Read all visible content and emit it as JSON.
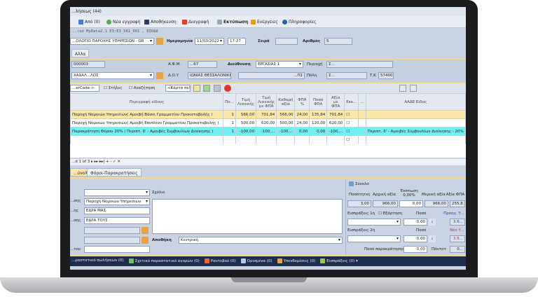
{
  "window": {
    "title": "...λήσεως (44)"
  },
  "toolbar": {
    "from": "Από (0)",
    "new": "Νέα εγγραφή",
    "save": "Αποθήκευση",
    "delete": "Διαγραφή",
    "print": "Εκτύπωση",
    "actions": "Ενέργειες",
    "info": "Πληροφορίες"
  },
  "path": "...ικό MyData2.1 Ε3:Ε3_561_001 , ΕΣΟΔΑ",
  "header": {
    "series": "...ΟΛΟΓΙΟ ΠΑΡΟΧΗΣ ΥΠΗΡΕΣΙΩΝ - GR",
    "date_label": "Ημερομηνία",
    "date": "11/03/2022",
    "time": "17:27",
    "seira_label": "Σειρά",
    "seira": "",
    "number_label": "Αριθμός",
    "number": "5"
  },
  "tabs_top": [
    "Αλλα"
  ],
  "customer": {
    "code": "000003",
    "name": "ΧΑΧΑΛ...ΛΟΣ",
    "afm_label": "Α.Φ.Μ.",
    "afm": "...67",
    "doy_label": "Δ.Ο.Υ",
    "doy": "ΙΩΝΙΑΣ ΘΕΣΣΑΛΟΝΙΚΗ",
    "address_label": "Διεύθυνση",
    "address": "ΕΡΓΑΣΙΑΣ 1",
    "area_label": "Περιοχή",
    "area": "Σ...",
    "street": "...ΠΣ",
    "city_label": "Πόλη",
    "city": "Σ...",
    "tk_label": "Τ.Κ",
    "tk": "57400"
  },
  "grid_toolbar": {
    "barcode": "...erCode >",
    "columns": "Στήλες",
    "search": "Αναζήτηση",
    "card": "<Κάρτα πελά"
  },
  "grid": {
    "headers": [
      "Περιγραφή είδους",
      "Πο...",
      "Τιμή Λιανικής",
      "Τιμή Λιανικής με ΦΠΑ",
      "Καθαρή αξία",
      "ΦΠΑ %",
      "Ποσό ΦΠΑ",
      "Αξία με ΦΠΑ",
      "Εκκ...",
      "...",
      "ΑΑΔΕ Είδος"
    ],
    "rows": [
      [
        "Παροχή Νομικών Υπηρεσιών( Αμοιβή Βάσει Γραμματίου Προκαταβολής )",
        "1",
        "566,00",
        "701,84",
        "566,00",
        "24,00",
        "135,84",
        "701,84",
        "",
        "",
        ""
      ],
      [
        "Παροχή Νομικών Υπηρεσιών( Αμοιβή Επιπλέον Γραμματίου Προκαταβολής )",
        "1",
        "500,00",
        "620,00",
        "500,00",
        "24,00",
        "120,00",
        "620,00",
        "",
        "",
        ""
      ],
      [
        "Παρακράτηση Φόρου 20% ( Περιπτ. δ' - Αμοιβές Συμβουλίων Διοίκησης )",
        "1",
        "-100,00",
        "-100,...",
        "-100,...",
        "0,00",
        "0,00",
        "-100,...",
        "",
        "",
        "Περιπτ. δ' - Αμοιβές Συμβουλίων Διοίκησης - 20%"
      ]
    ]
  },
  "nav": {
    "record": "...d 1 of 3"
  },
  "tabs_bottom": [
    "...ύνολο",
    "Φόροι-Παρακρατήσεις"
  ],
  "form": {
    "field2_label": "...σης",
    "field2": "Παροχή Νομικών Υπηρεσιών",
    "field3_label": "...ης",
    "field3": "ΕΔΡΑ ΜΑΣ",
    "field4_label": "...σης",
    "field4": "ΕΔΡΑ ΤΟΥΣ",
    "field7_label": "...του",
    "comment_label": "Σχόλιο",
    "warehouse_label": "Αποθήκη",
    "warehouse": "Κεντρική"
  },
  "totals": {
    "title": "Σύνολο",
    "qty_label": "Ποσότητες",
    "qty": "3,00",
    "initial_label": "Αρχική αξία",
    "initial": "966,00",
    "discount_label": "Έκπτωση 0,00%",
    "discount": "0,00",
    "net_label": "Μερική αξία",
    "net": "966,00",
    "vat_label": "Αξία ΦΠΑ",
    "vat": "255,8...",
    "rec1_label": "Εισπράξεις 1η",
    "dependency": "Εξάρτηση",
    "amount_label": "Ποσό",
    "rec1": "0,00",
    "rec2_label": "Εισπράξεις 2η",
    "rec2": "0,00",
    "prev_label": "Προηγ. Υ...",
    "prev": "3.6...",
    "new_label": "Νέο Υ...",
    "new": "3.6...",
    "withholding_label": "Ποσό παρακράτησης",
    "withholding": "0,00",
    "total_label": "Πάντοτ",
    "total": "0..."
  },
  "statusbar": [
    "...ραστατικό πωλήσεων (0)",
    "Σχετικό παραστατικό αγορών (0)",
    "Ραντεβού (0)",
    "Ορισμένα (0)",
    "Υπενθυμίσεις (0)",
    "Εισπράξεις (0) ▾"
  ],
  "colors": {
    "highlight_yellow": "#fde7a6",
    "highlight_cyan": "#6ff0f2",
    "statusbar": "#1f2d4d"
  }
}
